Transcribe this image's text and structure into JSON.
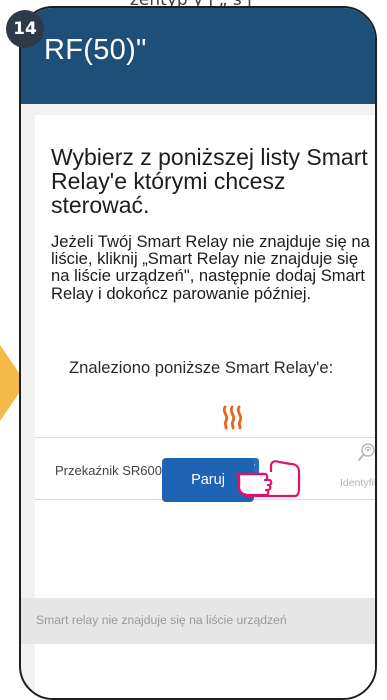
{
  "tutorial": {
    "step_number": "14",
    "top_caption": "zentyp y j „ s j"
  },
  "screen": {
    "header_text": "RF(50)\"",
    "heading": "Wybierz z poniższej listy Smart Relay'e którymi chcesz sterować.",
    "info": "Jeżeli Twój Smart Relay nie znajduje się na liście, kliknij „Smart Relay nie znajduje się na liście urządzeń\", następnie dodaj Smart Relay i dokończ parowanie później.",
    "found_label": "Znaleziono poniższe Smart Relay'e:",
    "device": {
      "icon": "heating-icon",
      "name": "Przekaźnik SR600",
      "checked": true,
      "identify_label": "Identyfikacja"
    },
    "pair_button": "Paruj",
    "footer_text": "Smart relay nie znajduje się na liście urządzeń"
  },
  "colors": {
    "header": "#1e4f78",
    "accent": "#1f63b4",
    "heat_icon": "#e8661c",
    "step_badge": "#2e3a49",
    "arrow": "#f5b949"
  }
}
